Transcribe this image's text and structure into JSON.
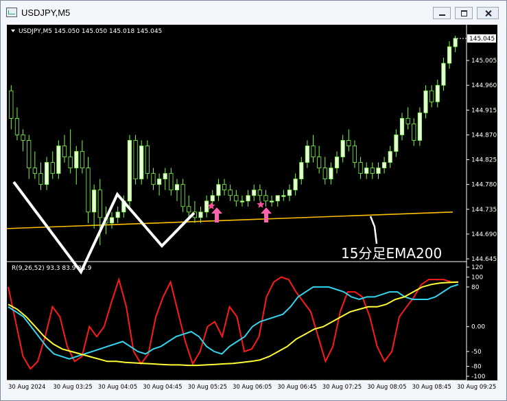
{
  "window": {
    "title": "USDJPY,M5"
  },
  "colors": {
    "background": "#000000",
    "axis": "#ffffff",
    "grid": "#222222",
    "bull_candle": "#e9ffd9",
    "bear_candle": "#000000",
    "wick": "#7dff3f",
    "ema": "#ffc000",
    "rci_short": "#ff1a1a",
    "rci_mid": "#33d6f0",
    "rci_long": "#ffff33",
    "signal_star": "#ff4fa0",
    "signal_arrow": "#ff60b0",
    "annotation": "#ffffff"
  },
  "main": {
    "header": "USDJPY,M5  145.050 145.050 145.018 145.045",
    "price_ticks": [
      "145.005",
      "144.960",
      "144.915",
      "144.870",
      "144.825",
      "144.780",
      "144.735",
      "144.690",
      "144.645"
    ],
    "last_price": "145.045",
    "annotation": "15分足EMA200",
    "icons": [
      "collapse-triangle-icon",
      "star-icon",
      "up-arrow-icon",
      "pencil-pointer-icon"
    ]
  },
  "sub": {
    "header": "R(9,26,52) 93.3 83.9 83.9",
    "ticks": [
      "120",
      "100",
      "80",
      "0.00",
      "-50",
      "-80",
      "-100"
    ]
  },
  "time_axis": [
    "30 Aug 2024",
    "30 Aug 03:25",
    "30 Aug 04:05",
    "30 Aug 04:45",
    "30 Aug 05:25",
    "30 Aug 06:05",
    "30 Aug 06:45",
    "30 Aug 07:25",
    "30 Aug 08:05",
    "30 Aug 08:45",
    "30 Aug 09:25"
  ],
  "chart_data": [
    {
      "type": "candlestick",
      "symbol": "USDJPY",
      "timeframe": "M5",
      "x_start": "30 Aug 2024",
      "x_end": "30 Aug 09:25",
      "ylim": [
        144.645,
        145.05
      ],
      "ohlc": [
        [
          144.95,
          144.96,
          144.88,
          144.9
        ],
        [
          144.9,
          144.92,
          144.86,
          144.87
        ],
        [
          144.87,
          144.88,
          144.84,
          144.86
        ],
        [
          144.86,
          144.87,
          144.79,
          144.81
        ],
        [
          144.81,
          144.84,
          144.79,
          144.8
        ],
        [
          144.8,
          144.82,
          144.77,
          144.78
        ],
        [
          144.78,
          144.83,
          144.77,
          144.82
        ],
        [
          144.82,
          144.84,
          144.79,
          144.8
        ],
        [
          144.8,
          144.86,
          144.79,
          144.85
        ],
        [
          144.85,
          144.87,
          144.82,
          144.83
        ],
        [
          144.83,
          144.88,
          144.8,
          144.81
        ],
        [
          144.81,
          144.85,
          144.78,
          144.84
        ],
        [
          144.84,
          144.86,
          144.8,
          144.81
        ],
        [
          144.81,
          144.83,
          144.71,
          144.73
        ],
        [
          144.73,
          144.78,
          144.7,
          144.77
        ],
        [
          144.77,
          144.79,
          144.67,
          144.72
        ],
        [
          144.72,
          144.74,
          144.69,
          144.71
        ],
        [
          144.71,
          144.73,
          144.7,
          144.72
        ],
        [
          144.72,
          144.74,
          144.71,
          144.73
        ],
        [
          144.73,
          144.76,
          144.72,
          144.75
        ],
        [
          144.75,
          144.87,
          144.74,
          144.86
        ],
        [
          144.86,
          144.87,
          144.78,
          144.79
        ],
        [
          144.79,
          144.86,
          144.78,
          144.85
        ],
        [
          144.85,
          144.86,
          144.79,
          144.8
        ],
        [
          144.8,
          144.81,
          144.77,
          144.78
        ],
        [
          144.78,
          144.8,
          144.76,
          144.79
        ],
        [
          144.79,
          144.81,
          144.77,
          144.8
        ],
        [
          144.8,
          144.81,
          144.76,
          144.77
        ],
        [
          144.77,
          144.79,
          144.75,
          144.78
        ],
        [
          144.78,
          144.79,
          144.73,
          144.74
        ],
        [
          144.74,
          144.76,
          144.72,
          144.73
        ],
        [
          144.73,
          144.75,
          144.71,
          144.72
        ],
        [
          144.72,
          144.74,
          144.71,
          144.73
        ],
        [
          144.73,
          144.76,
          144.72,
          144.75
        ],
        [
          144.75,
          144.77,
          144.74,
          144.76
        ],
        [
          144.76,
          144.79,
          144.75,
          144.78
        ],
        [
          144.78,
          144.79,
          144.76,
          144.77
        ],
        [
          144.77,
          144.78,
          144.75,
          144.76
        ],
        [
          144.76,
          144.77,
          144.74,
          144.75
        ],
        [
          144.75,
          144.76,
          144.74,
          144.75
        ],
        [
          144.75,
          144.77,
          144.74,
          144.76
        ],
        [
          144.76,
          144.78,
          144.75,
          144.77
        ],
        [
          144.77,
          144.78,
          144.75,
          144.76
        ],
        [
          144.76,
          144.77,
          144.74,
          144.75
        ],
        [
          144.75,
          144.76,
          144.74,
          144.75
        ],
        [
          144.75,
          144.76,
          144.74,
          144.76
        ],
        [
          144.76,
          144.77,
          144.75,
          144.76
        ],
        [
          144.76,
          144.78,
          144.75,
          144.77
        ],
        [
          144.77,
          144.8,
          144.76,
          144.79
        ],
        [
          144.79,
          144.83,
          144.78,
          144.82
        ],
        [
          144.82,
          144.86,
          144.81,
          144.85
        ],
        [
          144.85,
          144.87,
          144.82,
          144.83
        ],
        [
          144.83,
          144.85,
          144.8,
          144.81
        ],
        [
          144.81,
          144.83,
          144.78,
          144.79
        ],
        [
          144.79,
          144.82,
          144.78,
          144.81
        ],
        [
          144.81,
          144.84,
          144.8,
          144.83
        ],
        [
          144.83,
          144.87,
          144.82,
          144.86
        ],
        [
          144.86,
          144.88,
          144.84,
          144.85
        ],
        [
          144.85,
          144.86,
          144.81,
          144.82
        ],
        [
          144.82,
          144.83,
          144.79,
          144.8
        ],
        [
          144.8,
          144.82,
          144.79,
          144.81
        ],
        [
          144.81,
          144.82,
          144.79,
          144.8
        ],
        [
          144.8,
          144.82,
          144.79,
          144.81
        ],
        [
          144.81,
          144.83,
          144.8,
          144.82
        ],
        [
          144.82,
          144.85,
          144.81,
          144.84
        ],
        [
          144.84,
          144.88,
          144.83,
          144.87
        ],
        [
          144.87,
          144.91,
          144.86,
          144.9
        ],
        [
          144.9,
          144.92,
          144.88,
          144.89
        ],
        [
          144.89,
          144.9,
          144.85,
          144.86
        ],
        [
          144.86,
          144.92,
          144.85,
          144.91
        ],
        [
          144.91,
          144.96,
          144.9,
          144.95
        ],
        [
          144.95,
          144.96,
          144.92,
          144.93
        ],
        [
          144.93,
          144.97,
          144.92,
          144.96
        ],
        [
          144.96,
          145.01,
          144.95,
          145.0
        ],
        [
          145.0,
          145.04,
          144.99,
          145.03
        ],
        [
          145.03,
          145.05,
          145.02,
          145.045
        ]
      ],
      "ema200_15m": {
        "name": "15分足EMA200",
        "start": 144.7,
        "end": 144.73
      }
    },
    {
      "type": "line",
      "indicator": "R(9,26,52)",
      "ylim": [
        -100,
        120
      ],
      "series": [
        {
          "name": "9",
          "values": [
            80,
            10,
            -60,
            -85,
            -70,
            -20,
            40,
            20,
            -40,
            -70,
            -60,
            0,
            -20,
            0,
            50,
            95,
            40,
            -50,
            -75,
            -55,
            20,
            60,
            90,
            30,
            -30,
            -75,
            -50,
            0,
            10,
            -20,
            40,
            20,
            -50,
            -45,
            -20,
            60,
            90,
            100,
            95,
            70,
            50,
            30,
            -20,
            -70,
            -40,
            30,
            70,
            70,
            60,
            20,
            -40,
            -70,
            -50,
            20,
            40,
            60,
            85,
            95,
            95,
            95,
            90,
            90
          ]
        },
        {
          "name": "26",
          "values": [
            40,
            30,
            20,
            0,
            -20,
            -40,
            -55,
            -60,
            -65,
            -60,
            -55,
            -50,
            -45,
            -40,
            -35,
            -30,
            -40,
            -50,
            -55,
            -45,
            -40,
            -30,
            -20,
            -15,
            -10,
            -20,
            -40,
            -50,
            -55,
            -40,
            -30,
            -20,
            0,
            10,
            15,
            20,
            25,
            40,
            60,
            70,
            80,
            80,
            80,
            75,
            70,
            60,
            55,
            60,
            60,
            65,
            70,
            70,
            60,
            55,
            55,
            55,
            60,
            70,
            80,
            85
          ]
        },
        {
          "name": "52",
          "values": [
            45,
            35,
            20,
            0,
            -20,
            -35,
            -45,
            -50,
            -55,
            -60,
            -65,
            -70,
            -70,
            -72,
            -73,
            -74,
            -75,
            -76,
            -77,
            -77,
            -78,
            -78,
            -77,
            -76,
            -75,
            -74,
            -72,
            -70,
            -67,
            -60,
            -50,
            -40,
            -25,
            -15,
            -5,
            0,
            10,
            20,
            30,
            35,
            40,
            40,
            45,
            55,
            60,
            70,
            80,
            85,
            88,
            89,
            90
          ]
        }
      ]
    }
  ]
}
